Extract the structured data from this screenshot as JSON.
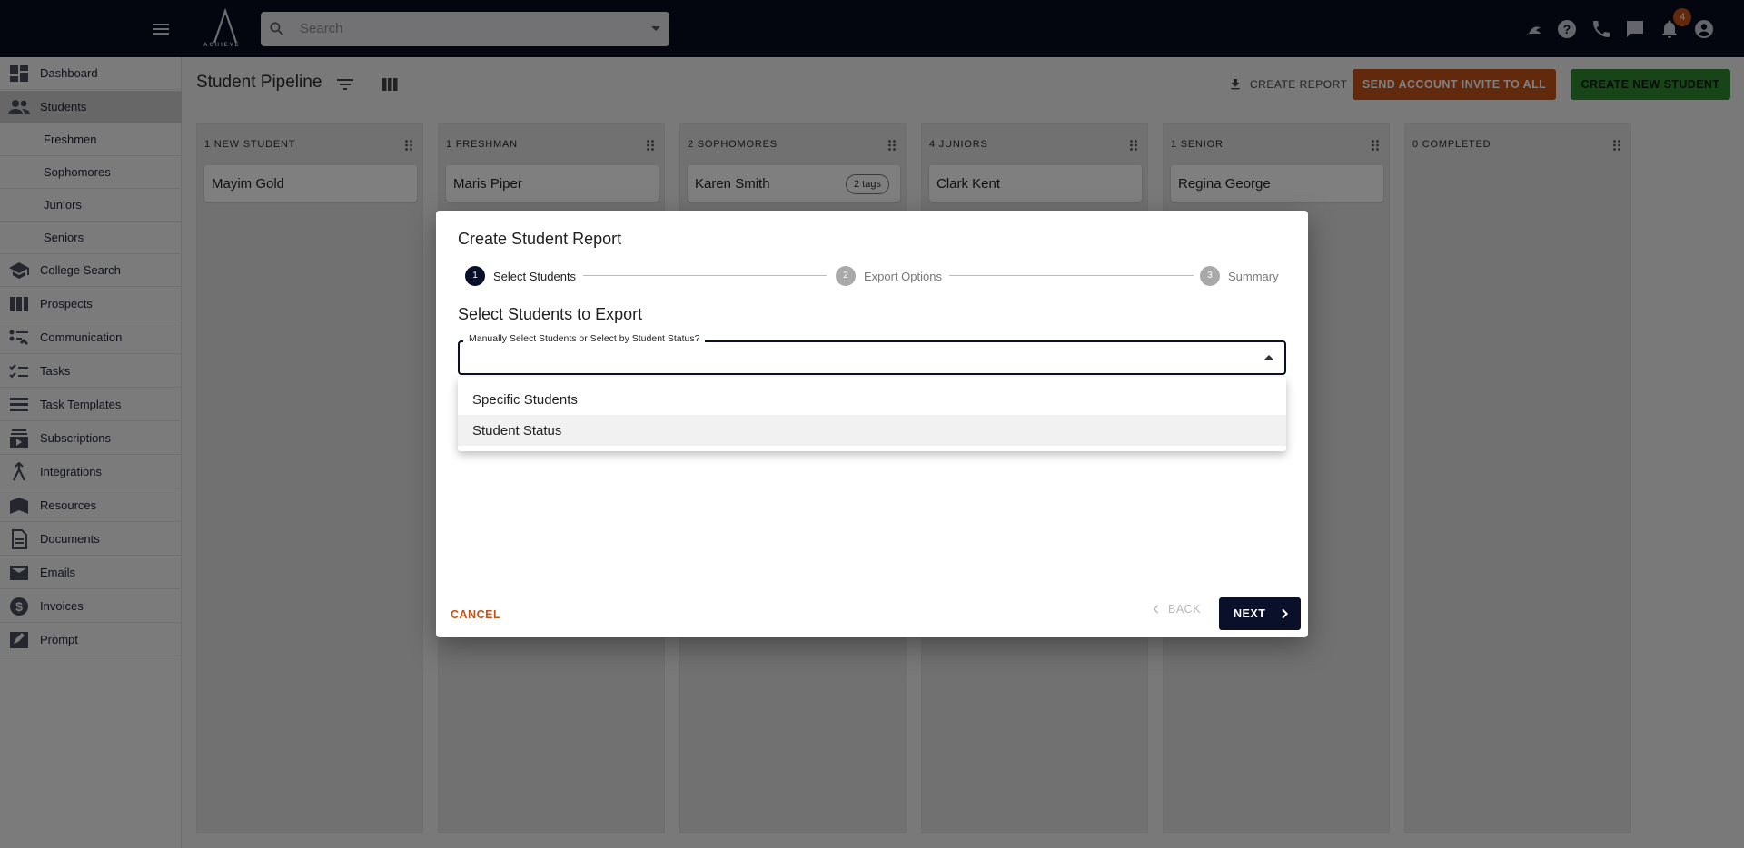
{
  "app": {
    "logo_text": "ACHIEVE",
    "search_placeholder": "Search",
    "notification_count": "4"
  },
  "sidebar": {
    "items": [
      {
        "label": "Dashboard",
        "icon": "dashboard-icon"
      },
      {
        "label": "Students",
        "icon": "people-icon",
        "active": true
      },
      {
        "label": "Freshmen",
        "sub": true
      },
      {
        "label": "Sophomores",
        "sub": true
      },
      {
        "label": "Juniors",
        "sub": true
      },
      {
        "label": "Seniors",
        "sub": true
      },
      {
        "label": "College Search",
        "icon": "school-icon"
      },
      {
        "label": "Prospects",
        "icon": "columns-icon"
      },
      {
        "label": "Communication",
        "icon": "communication-icon"
      },
      {
        "label": "Tasks",
        "icon": "checklist-icon"
      },
      {
        "label": "Task Templates",
        "icon": "list-icon"
      },
      {
        "label": "Subscriptions",
        "icon": "subscriptions-icon"
      },
      {
        "label": "Integrations",
        "icon": "merge-icon"
      },
      {
        "label": "Resources",
        "icon": "book-icon"
      },
      {
        "label": "Documents",
        "icon": "document-icon"
      },
      {
        "label": "Emails",
        "icon": "mail-icon"
      },
      {
        "label": "Invoices",
        "icon": "dollar-icon"
      },
      {
        "label": "Prompt",
        "icon": "edit-icon"
      }
    ]
  },
  "header": {
    "title": "Student Pipeline",
    "create_report": "CREATE REPORT",
    "invite_all": "SEND ACCOUNT INVITE TO ALL",
    "create_student": "CREATE NEW STUDENT"
  },
  "pipeline": {
    "columns": [
      {
        "title": "1 NEW STUDENT",
        "card": "Mayim Gold",
        "tags": ""
      },
      {
        "title": "1 FRESHMAN",
        "card": "Maris Piper",
        "tags": ""
      },
      {
        "title": "2 SOPHOMORES",
        "card": "Karen Smith",
        "tags": "2 tags"
      },
      {
        "title": "4 JUNIORS",
        "card": "Clark Kent",
        "tags": ""
      },
      {
        "title": "1 SENIOR",
        "card": "Regina George",
        "tags": ""
      },
      {
        "title": "0 COMPLETED",
        "card": "",
        "tags": ""
      }
    ]
  },
  "dialog": {
    "title": "Create Student Report",
    "steps": [
      {
        "num": "1",
        "label": "Select Students",
        "active": true
      },
      {
        "num": "2",
        "label": "Export Options",
        "active": false
      },
      {
        "num": "3",
        "label": "Summary",
        "active": false
      }
    ],
    "section_title": "Select Students to Export",
    "select_label": "Manually Select Students or Select by Student Status?",
    "select_value": "",
    "options": [
      "Specific Students",
      "Student Status"
    ],
    "cancel": "CANCEL",
    "back": "BACK",
    "next": "NEXT"
  },
  "colors": {
    "topbar": "#070b1e",
    "accent_orange": "#c4521a",
    "accent_green": "#2e8b2e",
    "primary_dark": "#0a0f2a"
  }
}
